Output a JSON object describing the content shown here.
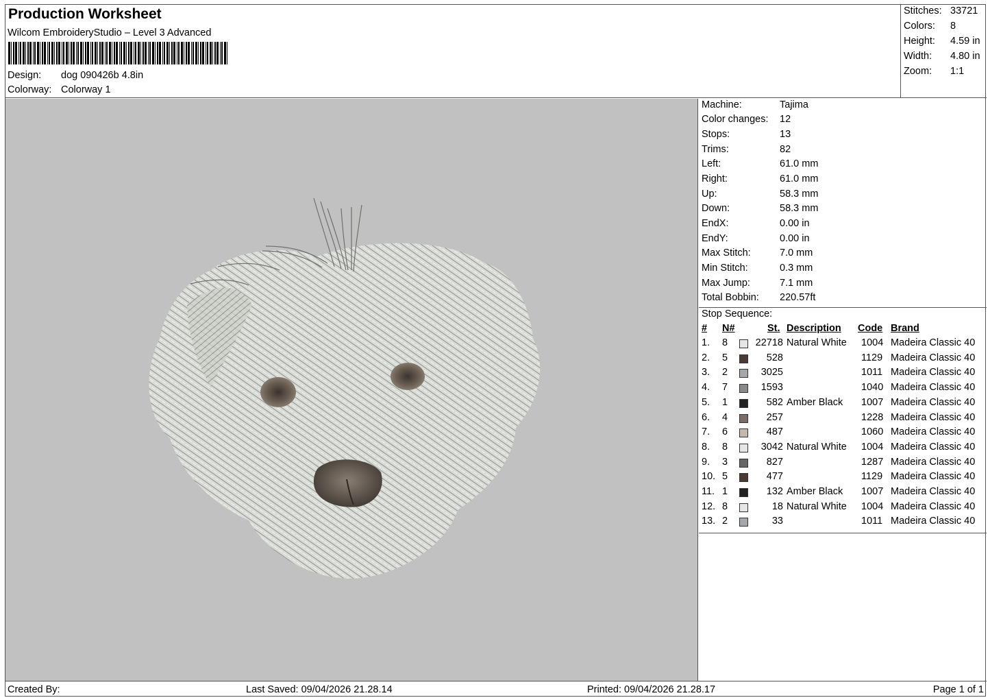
{
  "header": {
    "title": "Production Worksheet",
    "software": "Wilcom EmbroideryStudio – Level 3 Advanced",
    "design_label": "Design:",
    "design_value": "dog 090426b 4.8in",
    "colorway_label": "Colorway:",
    "colorway_value": "Colorway 1"
  },
  "summary": [
    {
      "label": "Stitches:",
      "value": "33721"
    },
    {
      "label": "Colors:",
      "value": "8"
    },
    {
      "label": "Height:",
      "value": "4.59 in"
    },
    {
      "label": "Width:",
      "value": "4.80 in"
    },
    {
      "label": "Zoom:",
      "value": "1:1"
    }
  ],
  "machine_info": [
    {
      "label": "Machine:",
      "value": "Tajima"
    },
    {
      "label": "Color changes:",
      "value": "12"
    },
    {
      "label": "Stops:",
      "value": "13"
    },
    {
      "label": "Trims:",
      "value": "82"
    },
    {
      "label": "Left:",
      "value": "61.0 mm"
    },
    {
      "label": "Right:",
      "value": "61.0 mm"
    },
    {
      "label": "Up:",
      "value": "58.3 mm"
    },
    {
      "label": "Down:",
      "value": "58.3 mm"
    },
    {
      "label": "EndX:",
      "value": "0.00 in"
    },
    {
      "label": "EndY:",
      "value": "0.00 in"
    },
    {
      "label": "Max Stitch:",
      "value": "7.0 mm"
    },
    {
      "label": "Min Stitch:",
      "value": "0.3 mm"
    },
    {
      "label": "Max Jump:",
      "value": "7.1 mm"
    },
    {
      "label": "Total Bobbin:",
      "value": "220.57ft"
    }
  ],
  "stop_sequence": {
    "title": "Stop Sequence:",
    "headers": {
      "idx": "#",
      "needle": "N#",
      "stitches": "St.",
      "description": "Description",
      "code": "Code",
      "brand": "Brand"
    },
    "rows": [
      {
        "idx": "1.",
        "needle": "8",
        "color": "#e6e6e4",
        "stitches": "22718",
        "description": "Natural White",
        "code": "1004",
        "brand": "Madeira Classic 40"
      },
      {
        "idx": "2.",
        "needle": "5",
        "color": "#4a3a36",
        "stitches": "528",
        "description": "",
        "code": "1129",
        "brand": "Madeira Classic 40"
      },
      {
        "idx": "3.",
        "needle": "2",
        "color": "#a5a8aa",
        "stitches": "3025",
        "description": "",
        "code": "1011",
        "brand": "Madeira Classic 40"
      },
      {
        "idx": "4.",
        "needle": "7",
        "color": "#8a8a8a",
        "stitches": "1593",
        "description": "",
        "code": "1040",
        "brand": "Madeira Classic 40"
      },
      {
        "idx": "5.",
        "needle": "1",
        "color": "#222222",
        "stitches": "582",
        "description": "Amber Black",
        "code": "1007",
        "brand": "Madeira Classic 40"
      },
      {
        "idx": "6.",
        "needle": "4",
        "color": "#7a6c66",
        "stitches": "257",
        "description": "",
        "code": "1228",
        "brand": "Madeira Classic 40"
      },
      {
        "idx": "7.",
        "needle": "6",
        "color": "#c2b8ae",
        "stitches": "487",
        "description": "",
        "code": "1060",
        "brand": "Madeira Classic 40"
      },
      {
        "idx": "8.",
        "needle": "8",
        "color": "#e6e6e4",
        "stitches": "3042",
        "description": "Natural White",
        "code": "1004",
        "brand": "Madeira Classic 40"
      },
      {
        "idx": "9.",
        "needle": "3",
        "color": "#666666",
        "stitches": "827",
        "description": "",
        "code": "1287",
        "brand": "Madeira Classic 40"
      },
      {
        "idx": "10.",
        "needle": "5",
        "color": "#4a3a36",
        "stitches": "477",
        "description": "",
        "code": "1129",
        "brand": "Madeira Classic 40"
      },
      {
        "idx": "11.",
        "needle": "1",
        "color": "#222222",
        "stitches": "132",
        "description": "Amber Black",
        "code": "1007",
        "brand": "Madeira Classic 40"
      },
      {
        "idx": "12.",
        "needle": "8",
        "color": "#e6e6e4",
        "stitches": "18",
        "description": "Natural White",
        "code": "1004",
        "brand": "Madeira Classic 40"
      },
      {
        "idx": "13.",
        "needle": "2",
        "color": "#a5a8aa",
        "stitches": "33",
        "description": "",
        "code": "1011",
        "brand": "Madeira Classic 40"
      }
    ]
  },
  "footer": {
    "created_by": "Created By:",
    "last_saved": "Last Saved: 09/04/2026 21.28.14",
    "printed": "Printed: 09/04/2026 21.28.17",
    "page": "Page 1 of 1"
  },
  "colors": {
    "preview_bg": "#c1c1c1",
    "fur": "#d9dbd6",
    "fur_shade": "#9a9c96",
    "nose": "#4e4640",
    "eye": "#5e5348"
  }
}
